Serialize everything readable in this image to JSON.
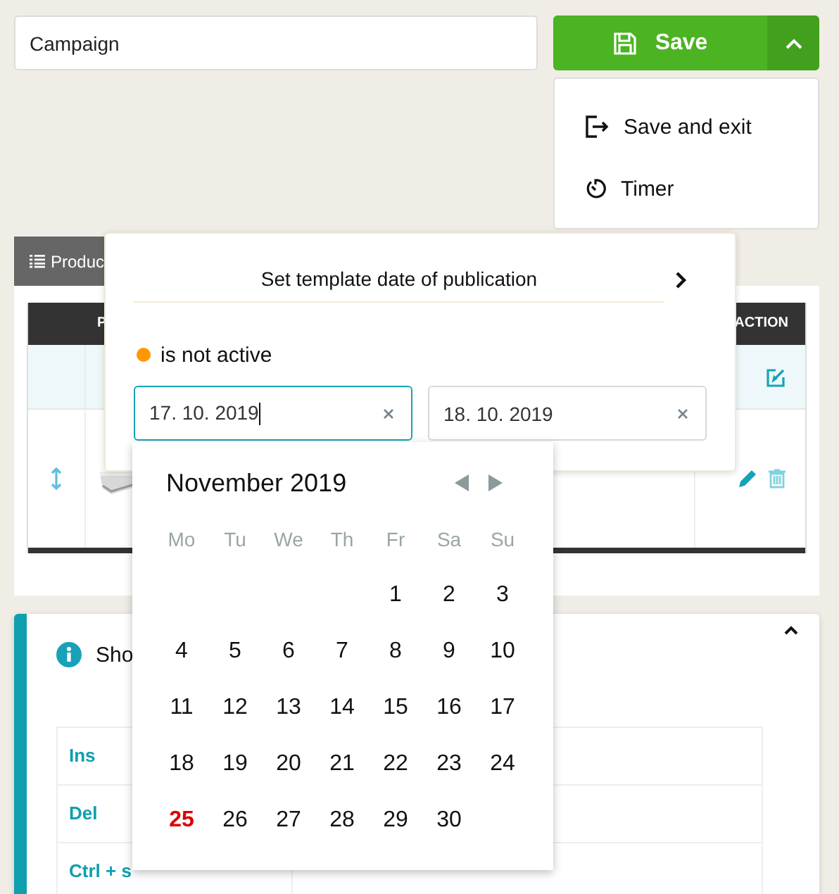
{
  "campaign": {
    "value": "Campaign"
  },
  "save_button": {
    "label": "Save"
  },
  "save_menu": {
    "expanded": true,
    "items": [
      {
        "kind": "exit",
        "label": "Save and exit"
      },
      {
        "kind": "timer",
        "label": "Timer"
      }
    ]
  },
  "tab": {
    "label": "Produc"
  },
  "table": {
    "columns": [
      "P",
      "ACTION"
    ]
  },
  "shortcuts": {
    "title": "Sho",
    "rows": [
      "Ins",
      "Del",
      "Ctrl + s"
    ]
  },
  "popover": {
    "title": "Set template date of publication",
    "status": {
      "label": "is not active",
      "active": false
    },
    "date_fields": [
      {
        "value": "17. 10. 2019",
        "focused": true
      },
      {
        "value": "18. 10. 2019",
        "focused": false
      }
    ]
  },
  "calendar": {
    "month": "November 2019",
    "weekdays": [
      "Mo",
      "Tu",
      "We",
      "Th",
      "Fr",
      "Sa",
      "Su"
    ],
    "weeks": [
      [
        {
          "day": "1",
          "today": false
        },
        {
          "day": "2",
          "today": false
        },
        {
          "day": "3",
          "today": false
        }
      ],
      [
        {
          "day": "4",
          "today": false
        },
        {
          "day": "5",
          "today": false
        },
        {
          "day": "6",
          "today": false
        },
        {
          "day": "7",
          "today": false
        },
        {
          "day": "8",
          "today": false
        },
        {
          "day": "9",
          "today": false
        },
        {
          "day": "10",
          "today": false
        }
      ],
      [
        {
          "day": "11",
          "today": false
        },
        {
          "day": "12",
          "today": false
        },
        {
          "day": "13",
          "today": false
        },
        {
          "day": "14",
          "today": false
        },
        {
          "day": "15",
          "today": false
        },
        {
          "day": "16",
          "today": false
        },
        {
          "day": "17",
          "today": false
        }
      ],
      [
        {
          "day": "18",
          "today": false
        },
        {
          "day": "19",
          "today": false
        },
        {
          "day": "20",
          "today": false
        },
        {
          "day": "21",
          "today": false
        },
        {
          "day": "22",
          "today": false
        },
        {
          "day": "23",
          "today": false
        },
        {
          "day": "24",
          "today": false
        }
      ],
      [
        {
          "day": "25",
          "today": true
        },
        {
          "day": "26",
          "today": false
        },
        {
          "day": "27",
          "today": false
        },
        {
          "day": "28",
          "today": false
        },
        {
          "day": "29",
          "today": false
        },
        {
          "day": "30",
          "today": false
        }
      ]
    ]
  }
}
